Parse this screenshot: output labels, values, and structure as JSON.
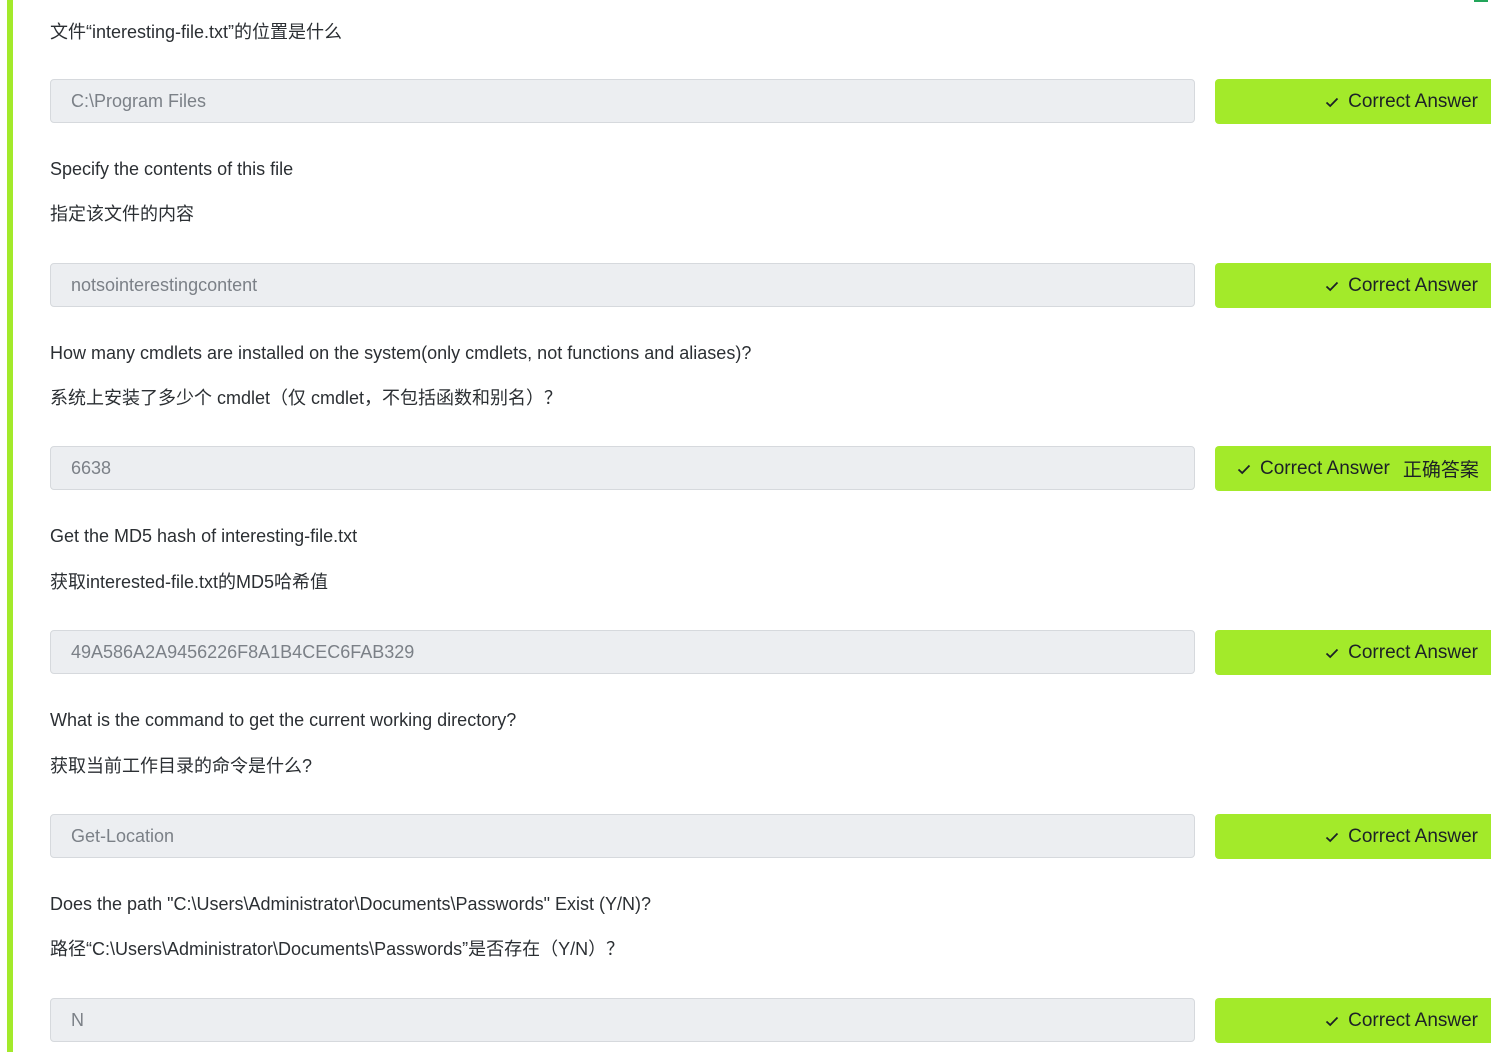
{
  "colors": {
    "accent": "#a3ea2a",
    "field_bg": "#eceef1",
    "text": "#2b2f33",
    "field_text": "#7b8087"
  },
  "questions": [
    {
      "q_en": "",
      "q_zh": "文件“interesting-file.txt”的位置是什么",
      "answer": "C:\\Program Files",
      "button_label": "Correct Answer",
      "button_extra": ""
    },
    {
      "q_en": "Specify the contents of this file",
      "q_zh": "指定该文件的内容",
      "answer": "notsointerestingcontent",
      "button_label": "Correct Answer",
      "button_extra": ""
    },
    {
      "q_en": "How many cmdlets are installed on the system(only cmdlets, not functions and aliases)?",
      "q_zh": "系统上安装了多少个 cmdlet（仅 cmdlet，不包括函数和别名）？",
      "answer": "6638",
      "button_label": "Correct Answer",
      "button_extra": "正确答案"
    },
    {
      "q_en": "Get the MD5 hash of interesting-file.txt",
      "q_zh": "获取interested-file.txt的MD5哈希值",
      "answer": "49A586A2A9456226F8A1B4CEC6FAB329",
      "button_label": "Correct Answer",
      "button_extra": ""
    },
    {
      "q_en": "What is the command to get the current working directory?",
      "q_zh": "获取当前工作目录的命令是什么?",
      "answer": "Get-Location",
      "button_label": "Correct Answer",
      "button_extra": ""
    },
    {
      "q_en": "Does the path \"C:\\Users\\Administrator\\Documents\\Passwords\" Exist (Y/N)?",
      "q_zh": "路径“C:\\Users\\Administrator\\Documents\\Passwords”是否存在（Y/N）？",
      "answer": "N",
      "button_label": "Correct Answer",
      "button_extra": ""
    }
  ]
}
